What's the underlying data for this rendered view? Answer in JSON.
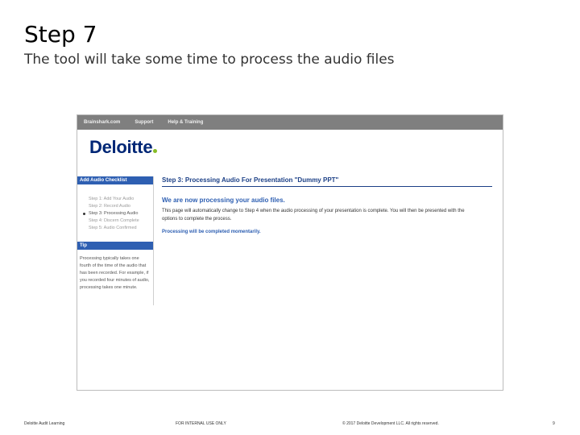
{
  "slide": {
    "title": "Step 7",
    "subtitle": "The tool will take some time to process the audio files"
  },
  "screenshot": {
    "nav": [
      "Brainshark.com",
      "Support",
      "Help & Training"
    ],
    "logo_text": "Deloitte",
    "sidebar": {
      "checklist_header": "Add Audio Checklist",
      "checklist_items": [
        "Step 1: Add Your Audio",
        "Step 2: Record Audio",
        "Step 3: Processing Audio",
        "Step 4: Discern Complete",
        "Step 5: Audio Confirmed"
      ],
      "active_index": 2,
      "tip_header": "Tip",
      "tip_text": "Processing typically takes one fourth of the time of the audio that has been recorded. For example, if you recorded four minutes of audio, processing takes one minute."
    },
    "main": {
      "header": "Step 3: Processing Audio For Presentation \"Dummy PPT\"",
      "subheader": "We are now processing your audio files.",
      "paragraph": "This page will automatically change to Step 4 when the audio processing of your presentation is complete. You will then be presented with the options to complete the process.",
      "note": "Processing will be completed momentarily."
    },
    "colors": {
      "brand_blue": "#002776",
      "brand_green": "#86bc25",
      "header_blue": "#2e5fb2",
      "nav_gray": "#7f7f7f"
    }
  },
  "footer": {
    "left": "Deloitte Audit Learning",
    "center": "FOR INTERNAL USE ONLY",
    "right": "© 2017 Deloitte Development LLC. All rights reserved.",
    "page": "9"
  }
}
